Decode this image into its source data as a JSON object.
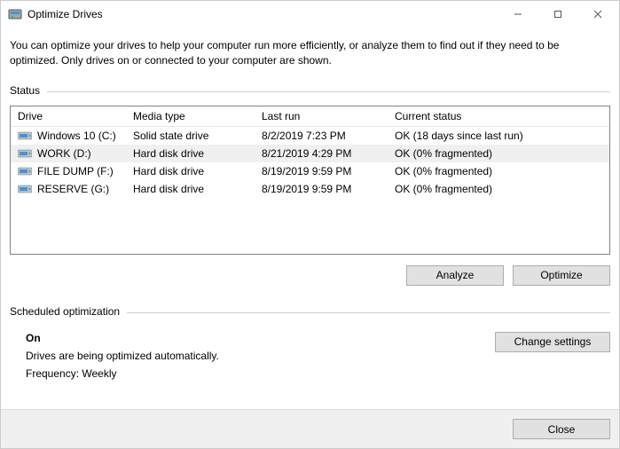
{
  "window": {
    "title": "Optimize Drives"
  },
  "description": "You can optimize your drives to help your computer run more efficiently, or analyze them to find out if they need to be optimized. Only drives on or connected to your computer are shown.",
  "status_label": "Status",
  "columns": {
    "drive": "Drive",
    "media": "Media type",
    "lastrun": "Last run",
    "status": "Current status"
  },
  "drives": [
    {
      "name": "Windows 10 (C:)",
      "media": "Solid state drive",
      "lastrun": "8/2/2019 7:23 PM",
      "status": "OK (18 days since last run)",
      "selected": false
    },
    {
      "name": "WORK (D:)",
      "media": "Hard disk drive",
      "lastrun": "8/21/2019 4:29 PM",
      "status": "OK (0% fragmented)",
      "selected": true
    },
    {
      "name": "FILE DUMP (F:)",
      "media": "Hard disk drive",
      "lastrun": "8/19/2019 9:59 PM",
      "status": "OK (0% fragmented)",
      "selected": false
    },
    {
      "name": "RESERVE (G:)",
      "media": "Hard disk drive",
      "lastrun": "8/19/2019 9:59 PM",
      "status": "OK (0% fragmented)",
      "selected": false
    }
  ],
  "buttons": {
    "analyze": "Analyze",
    "optimize": "Optimize",
    "change_settings": "Change settings",
    "close": "Close"
  },
  "scheduled": {
    "label": "Scheduled optimization",
    "state": "On",
    "desc": "Drives are being optimized automatically.",
    "freq": "Frequency: Weekly"
  }
}
